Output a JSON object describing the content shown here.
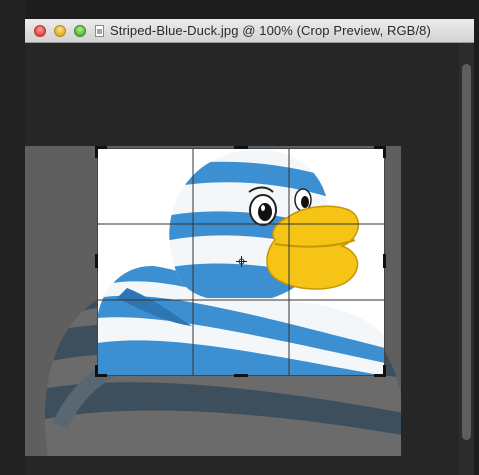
{
  "window": {
    "title": "Striped-Blue-Duck.jpg @ 100% (Crop Preview, RGB/8)",
    "traffic_lights": [
      "close",
      "minimize",
      "zoom"
    ]
  },
  "crop_preview": {
    "image_subject": "blue and white striped rubber duck with yellow beak",
    "grid": "rule of thirds",
    "colors": {
      "canvas": "#262626",
      "shield_overlay": "#5f5f5f",
      "duck_blue": "#3c8fd0",
      "duck_white": "#f4f7fa",
      "beak": "#f5c416",
      "grid_line": "#333333"
    }
  }
}
